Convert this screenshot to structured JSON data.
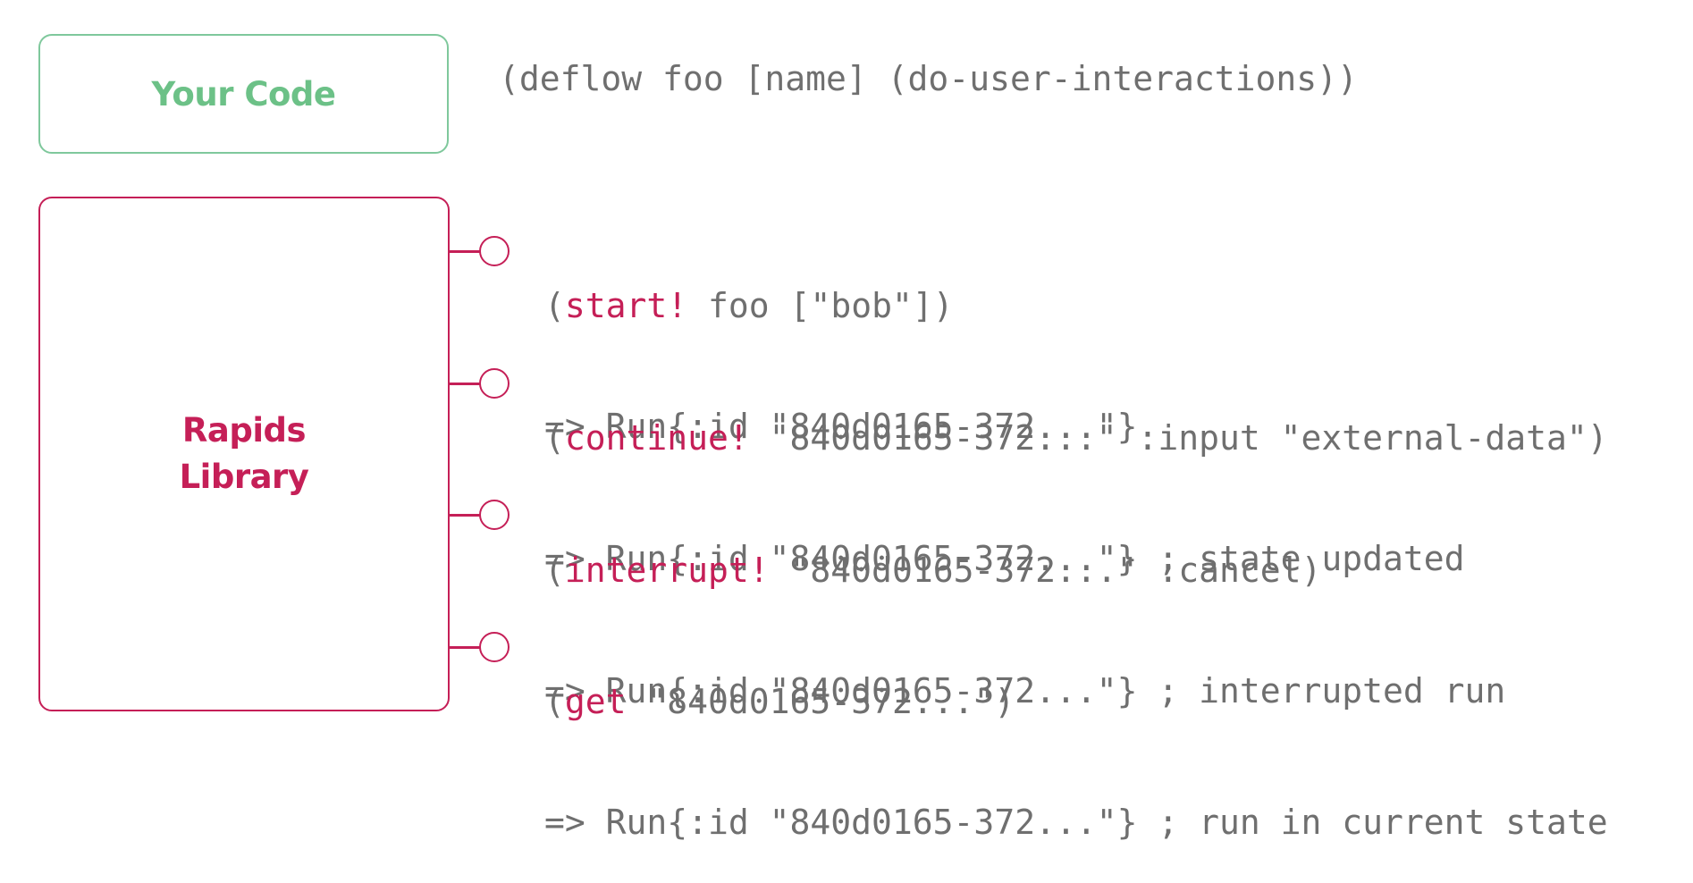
{
  "your_code_box": {
    "label": "Your Code"
  },
  "rapids_box": {
    "label": "Rapids\nLibrary"
  },
  "deflow_code": "(deflow foo [name] (do-user-interactions))",
  "api_calls": [
    {
      "open": "(",
      "fn": "start!",
      "args": " foo [\"bob\"])",
      "result": "=> Run{:id \"840d0165-372...\"}"
    },
    {
      "open": "(",
      "fn": "continue!",
      "args": " \"840d0165-372...\" :input \"external-data\")",
      "result": "=> Run{:id \"840d0165-372...\"} ; state updated"
    },
    {
      "open": "(",
      "fn": "interrupt!",
      "args": " \"840d0165-372...\" :cancel)",
      "result": "=> Run{:id \"840d0165-372...\"} ; interrupted run"
    },
    {
      "open": "(",
      "fn": "get",
      "args": " \"840d0165-372...\")",
      "result": "=> Run{:id \"840d0165-372...\"} ; run in current state"
    }
  ],
  "colors": {
    "your_code_accent": "#6cc187",
    "rapids_accent": "#c51f57",
    "code_text": "#6f6f6f"
  }
}
